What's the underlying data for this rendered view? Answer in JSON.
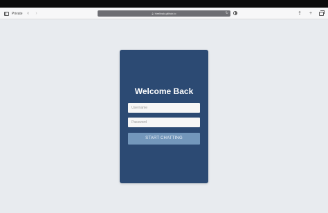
{
  "browser": {
    "private_label": "Private",
    "url": "hirelivak.github.io",
    "icons": [
      "sidebar-icon",
      "back-icon",
      "forward-icon",
      "lock-icon",
      "reload-icon",
      "reader-icon",
      "share-icon",
      "new-tab-icon",
      "tabs-overview-icon"
    ]
  },
  "login": {
    "title": "Welcome Back",
    "username_placeholder": "Username",
    "password_placeholder": "Password",
    "username_value": "",
    "password_value": "",
    "submit_label": "START CHATTING"
  },
  "colors": {
    "page_background": "#e8ebef",
    "card_background": "#2c4a73",
    "button_background": "#7397bb",
    "title_text": "#ffffff"
  }
}
